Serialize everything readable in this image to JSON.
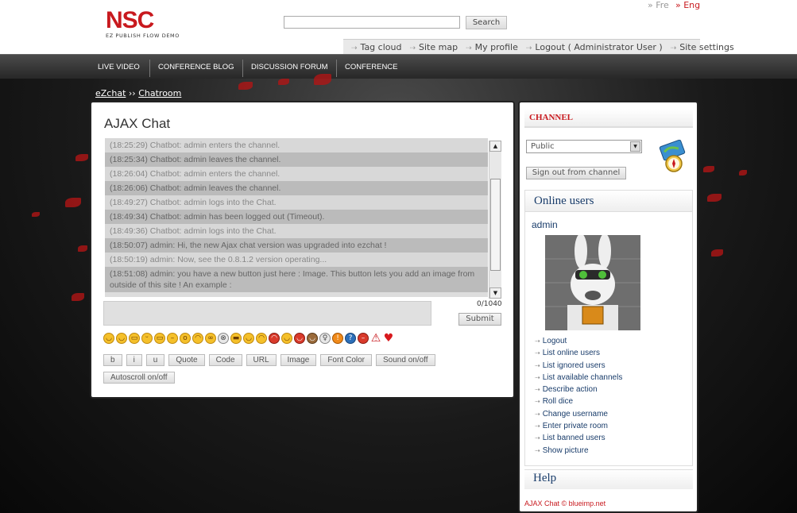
{
  "brand": {
    "logo_text": "NSC",
    "tagline": "EZ PUBLISH FLOW DEMO"
  },
  "languages": [
    {
      "label": "Fre",
      "active": false
    },
    {
      "label": "Eng",
      "active": true
    }
  ],
  "search": {
    "button_label": "Search",
    "value": ""
  },
  "toolbar": {
    "items": [
      "Tag cloud",
      "Site map",
      "My profile",
      "Logout ( Administrator User )",
      "Site settings"
    ]
  },
  "nav": {
    "items": [
      "LIVE VIDEO",
      "CONFERENCE BLOG",
      "DISCUSSION FORUM",
      "CONFERENCE"
    ]
  },
  "breadcrumb": {
    "root": "eZchat",
    "separator": "››",
    "current": "Chatroom"
  },
  "chat": {
    "title": "AJAX Chat",
    "messages": [
      "(18:25:29) Chatbot: admin enters the channel.",
      "(18:25:34) Chatbot: admin leaves the channel.",
      "(18:26:04) Chatbot: admin enters the channel.",
      "(18:26:06) Chatbot: admin leaves the channel.",
      "(18:49:27) Chatbot: admin logs into the Chat.",
      "(18:49:34) Chatbot: admin has been logged out (Timeout).",
      "(18:49:36) Chatbot: admin logs into the Chat.",
      "(18:50:07) admin: Hi, the new Ajax chat version was upgraded into ezchat !",
      "(18:50:19) admin: Now, see the 0.8.1.2 version operating...",
      "(18:51:08) admin: you have a new button just here : Image. This button lets you add an image from outside of this site ! An example :"
    ],
    "char_count": "0/1040",
    "submit_label": "Submit",
    "emoticons": [
      "smile",
      "wink",
      "grin",
      "tongue",
      "laugh",
      "neutral",
      "surprise",
      "sad",
      "nerd",
      "cross-eyed",
      "cool",
      "blush",
      "crying",
      "angry",
      "happy",
      "devil",
      "monkey",
      "idea",
      "exclamation",
      "question",
      "no-entry",
      "warning",
      "heart"
    ],
    "format_buttons": [
      "b",
      "i",
      "u",
      "Quote",
      "Code",
      "URL",
      "Image",
      "Font Color",
      "Sound on/off"
    ],
    "autoscroll_label": "Autoscroll on/off"
  },
  "sidebar": {
    "channel_title": "CHANNEL",
    "channel_selected": "Public",
    "signout_label": "Sign out from channel",
    "online_title": "Online users",
    "user_name": "admin",
    "user_menu": [
      "Logout",
      "List online users",
      "List ignored users",
      "List available channels",
      "Describe action",
      "Roll dice",
      "Change username",
      "Enter private room",
      "List banned users",
      "Show picture"
    ],
    "help_title": "Help",
    "credit": "AJAX Chat © blueimp.net"
  },
  "colors": {
    "brand_red": "#c8191e",
    "link_blue": "#1a3d6b",
    "nav_bg": "#333333"
  }
}
